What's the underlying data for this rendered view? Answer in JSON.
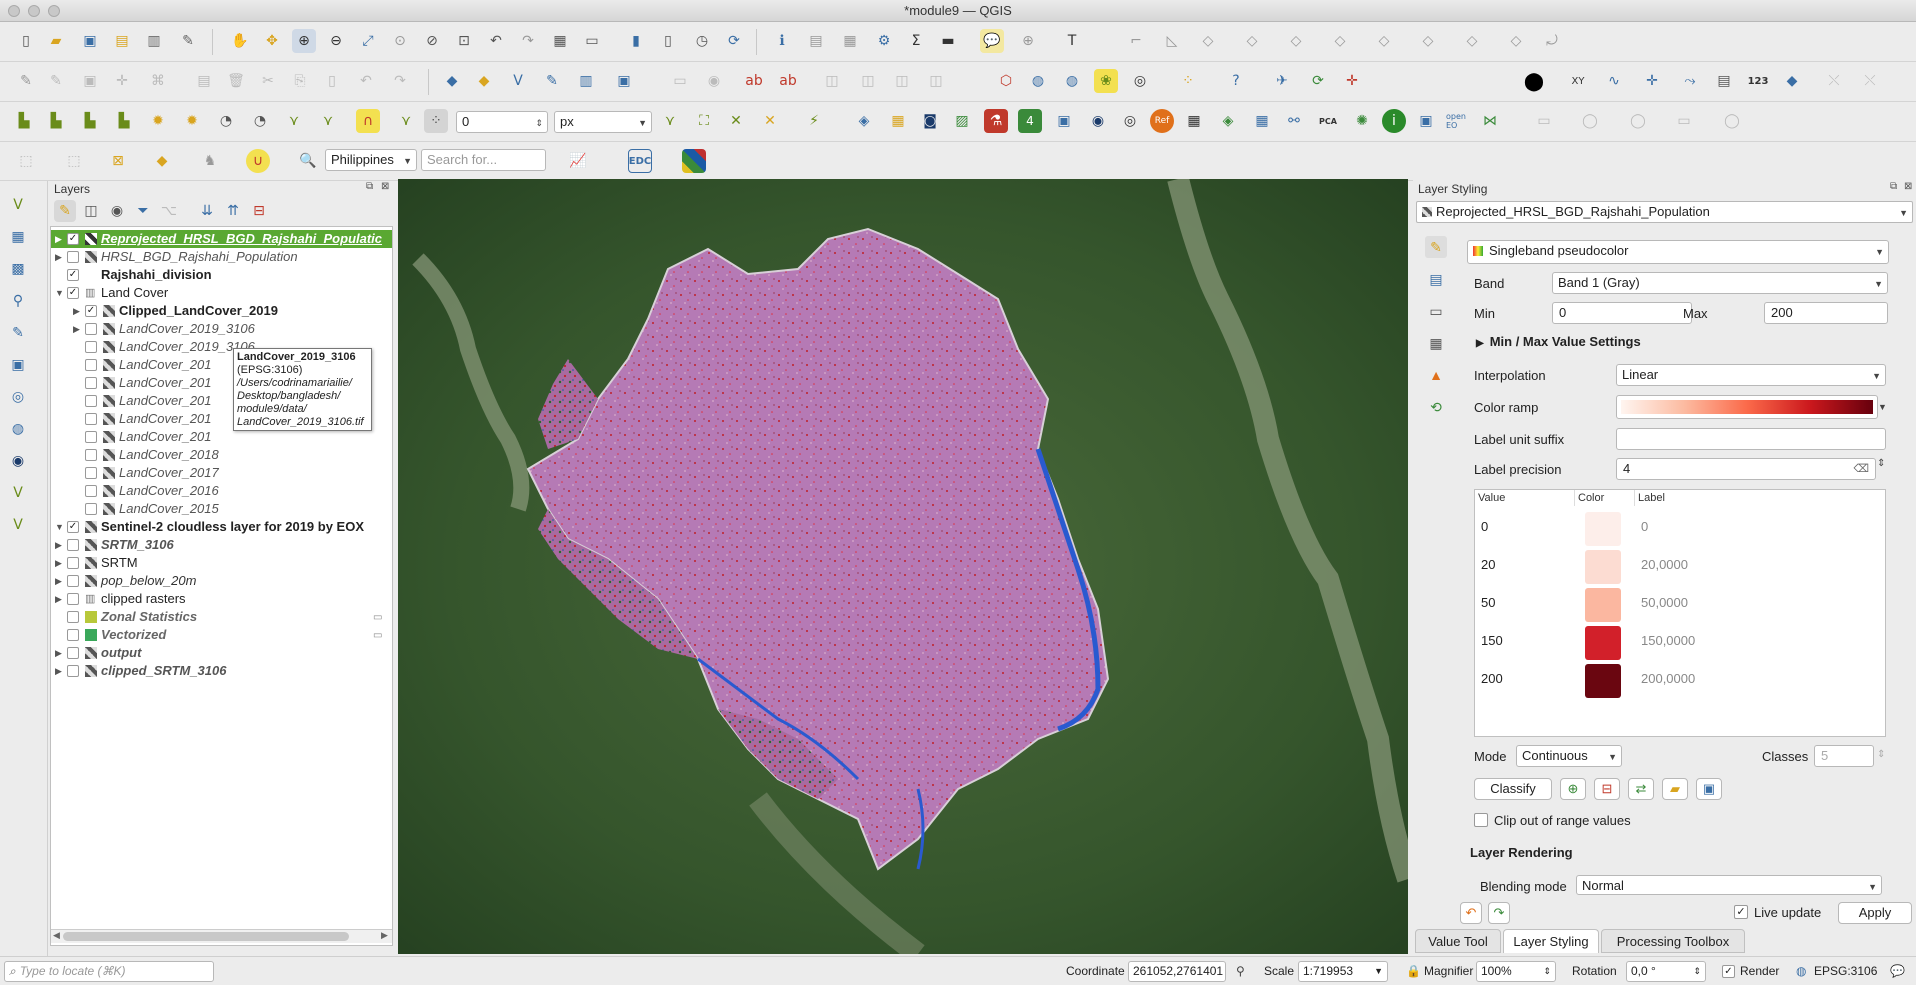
{
  "window": {
    "title": "*module9 — QGIS"
  },
  "toolbar": {
    "snap_tolerance": "0",
    "snap_units": "px",
    "country": "Philippines",
    "search_placeholder": "Search for...",
    "edc_label": "EDC",
    "badge_ref": "Ref",
    "badge_4": "4",
    "badge_pca": "PCA",
    "badge_openeo": "open EO",
    "badge_123": "123",
    "badge_xy": "XY"
  },
  "layers_panel": {
    "title": "Layers",
    "items": [
      {
        "label": "Reprojected_HRSL_BGD_Rajshahi_Populatic",
        "checked": true
      },
      {
        "label": "HRSL_BGD_Rajshahi_Population",
        "checked": false
      },
      {
        "label": "Rajshahi_division",
        "checked": true
      },
      {
        "label": "Land Cover",
        "checked": true
      },
      {
        "label": "Clipped_LandCover_2019",
        "checked": true
      },
      {
        "label": "LandCover_2019_3106",
        "checked": false
      },
      {
        "label": "LandCover_2019_3106",
        "checked": false
      },
      {
        "label": "LandCover_201",
        "checked": false
      },
      {
        "label": "LandCover_201",
        "checked": false
      },
      {
        "label": "LandCover_201",
        "checked": false
      },
      {
        "label": "LandCover_201",
        "checked": false
      },
      {
        "label": "LandCover_201",
        "checked": false
      },
      {
        "label": "LandCover_2018",
        "checked": false
      },
      {
        "label": "LandCover_2017",
        "checked": false
      },
      {
        "label": "LandCover_2016",
        "checked": false
      },
      {
        "label": "LandCover_2015",
        "checked": false
      },
      {
        "label": "Sentinel-2 cloudless layer for 2019 by EOX",
        "checked": true
      },
      {
        "label": "SRTM_3106",
        "checked": false
      },
      {
        "label": "SRTM",
        "checked": false
      },
      {
        "label": "pop_below_20m",
        "checked": false
      },
      {
        "label": "clipped rasters",
        "checked": false
      },
      {
        "label": "Zonal Statistics",
        "checked": false
      },
      {
        "label": "Vectorized",
        "checked": false
      },
      {
        "label": "output",
        "checked": false
      },
      {
        "label": "clipped_SRTM_3106",
        "checked": false
      }
    ],
    "tooltip": {
      "line1": "LandCover_2019_3106",
      "line2": "(EPSG:3106)",
      "line3": "/Users/codrinamariailie/",
      "line4": "Desktop/bangladesh/",
      "line5": "module9/data/",
      "line6": "LandCover_2019_3106.tif"
    }
  },
  "styling_panel": {
    "title": "Layer Styling",
    "layer": "Reprojected_HRSL_BGD_Rajshahi_Population",
    "renderer": "Singleband pseudocolor",
    "band_label": "Band",
    "band": "Band 1 (Gray)",
    "min_label": "Min",
    "min": "0",
    "max_label": "Max",
    "max": "200",
    "minmax_settings": "Min / Max Value Settings",
    "interpolation_label": "Interpolation",
    "interpolation": "Linear",
    "color_ramp_label": "Color ramp",
    "label_unit_suffix_label": "Label unit suffix",
    "label_unit_suffix": "",
    "label_precision_label": "Label precision",
    "label_precision": "4",
    "table_headers": {
      "value": "Value",
      "color": "Color",
      "label": "Label"
    },
    "classes": [
      {
        "value": "0",
        "color": "#fdeeea",
        "label": "0"
      },
      {
        "value": "20",
        "color": "#fcdcd2",
        "label": "20,0000"
      },
      {
        "value": "50",
        "color": "#fbb7a0",
        "label": "50,0000"
      },
      {
        "value": "150",
        "color": "#d2202a",
        "label": "150,0000"
      },
      {
        "value": "200",
        "color": "#6a0610",
        "label": "200,0000"
      }
    ],
    "mode_label": "Mode",
    "mode": "Continuous",
    "classes_label": "Classes",
    "classes_count": "5",
    "classify_button": "Classify",
    "clip_label": "Clip out of range values",
    "layer_rendering": "Layer Rendering",
    "blending_label": "Blending mode",
    "blending": "Normal",
    "live_update": "Live update",
    "apply_button": "Apply"
  },
  "tabs": [
    "Value Tool",
    "Layer Styling",
    "Processing Toolbox"
  ],
  "status": {
    "locate_placeholder": "Type to locate (⌘K)",
    "coordinate_label": "Coordinate",
    "coordinate": "261052,2761401",
    "scale_label": "Scale",
    "scale": "1:719953",
    "magnifier_label": "Magnifier",
    "magnifier": "100%",
    "rotation_label": "Rotation",
    "rotation": "0,0 °",
    "render_label": "Render",
    "crs": "EPSG:3106"
  }
}
